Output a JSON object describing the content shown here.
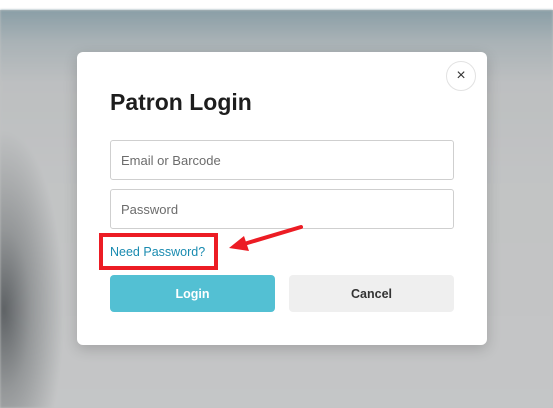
{
  "modal": {
    "title": "Patron Login",
    "close_symbol": "×",
    "email_placeholder": "Email or Barcode",
    "password_placeholder": "Password",
    "need_password_link": "Need Password?",
    "login_button": "Login",
    "cancel_button": "Cancel"
  },
  "annotation": {
    "highlight_color": "#ec1c24",
    "icon": "red-arrow-icon"
  },
  "colors": {
    "primary": "#53c0d3",
    "link": "#1a8bb0",
    "cancel_bg": "#efefef"
  }
}
